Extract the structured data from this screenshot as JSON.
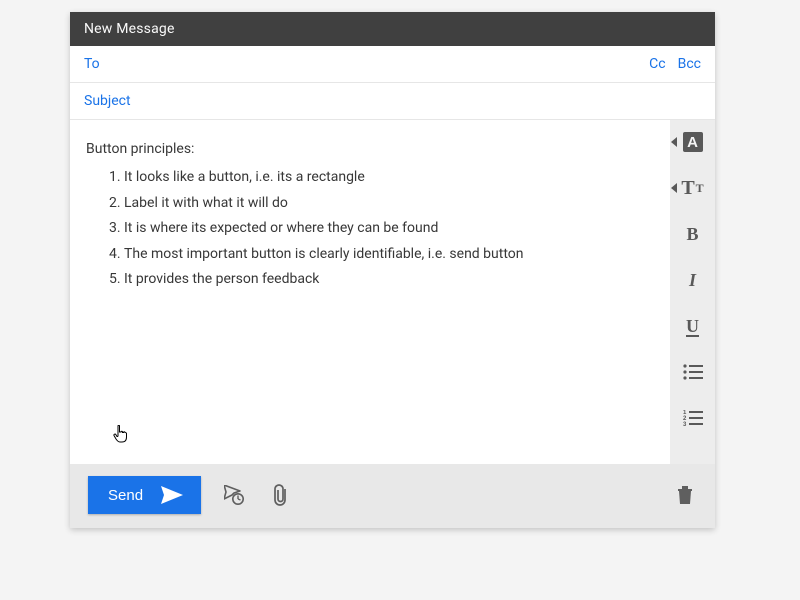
{
  "window": {
    "title": "New Message"
  },
  "fields": {
    "to_label": "To",
    "cc_label": "Cc",
    "bcc_label": "Bcc",
    "subject_label": "Subject"
  },
  "body": {
    "heading": "Button principles:",
    "items": [
      "It looks like a button, i.e. its a rectangle",
      "Label it with what it will do",
      "It is where its expected or where they can be found",
      "The most important button is clearly identifiable, i.e. send button",
      "It provides the person feedback"
    ]
  },
  "toolbar": {
    "text_color": "A",
    "text_size_big": "T",
    "text_size_small": "T",
    "bold": "B",
    "italic": "I",
    "underline": "U"
  },
  "footer": {
    "send_label": "Send"
  },
  "colors": {
    "accent": "#1A73E8",
    "titlebar": "#404040"
  }
}
